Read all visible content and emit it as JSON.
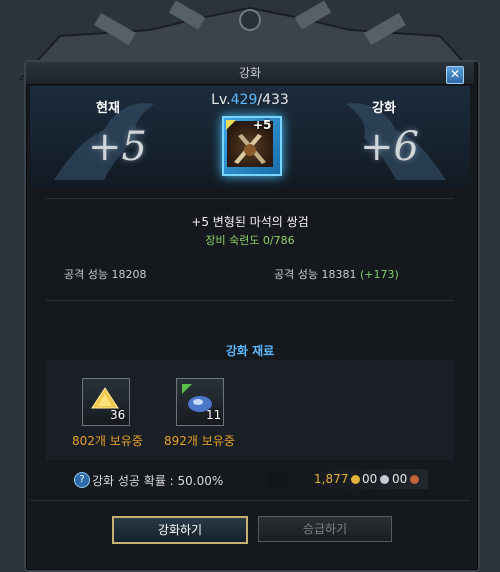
{
  "window": {
    "title": "강화",
    "close_label": "✕"
  },
  "header": {
    "current_label": "현재",
    "enhance_label": "강화",
    "current_level": "+5",
    "next_level": "+6",
    "lv_prefix": "Lv.",
    "lv_current": "429",
    "lv_max": "/433",
    "item_plus": "+5"
  },
  "item": {
    "name": "+5 변형된 마석의 쌍검",
    "proficiency": "장비 숙련도 0/786",
    "attack_current": "공격 성능 18208",
    "attack_next": "공격 성능 18381",
    "attack_gain": "(+173)"
  },
  "materials": {
    "title": "강화 재료",
    "list": [
      {
        "count": "36",
        "owned": "802개 보유중",
        "icon": "gold-crystal-icon"
      },
      {
        "count": "11",
        "owned": "892개 보유중",
        "icon": "blue-gem-icon"
      }
    ]
  },
  "footer": {
    "help_icon": "?",
    "success_rate": "강화 성공 확률 : 50.00%",
    "gold": "1,877",
    "silver": "00",
    "copper": "00"
  },
  "buttons": {
    "enhance": "강화하기",
    "upgrade": "승급하기"
  },
  "colors": {
    "accent_blue": "#5fb7ff",
    "green": "#8dd06a",
    "orange": "#e4a02c",
    "gold_coin": "#e3b23c"
  }
}
